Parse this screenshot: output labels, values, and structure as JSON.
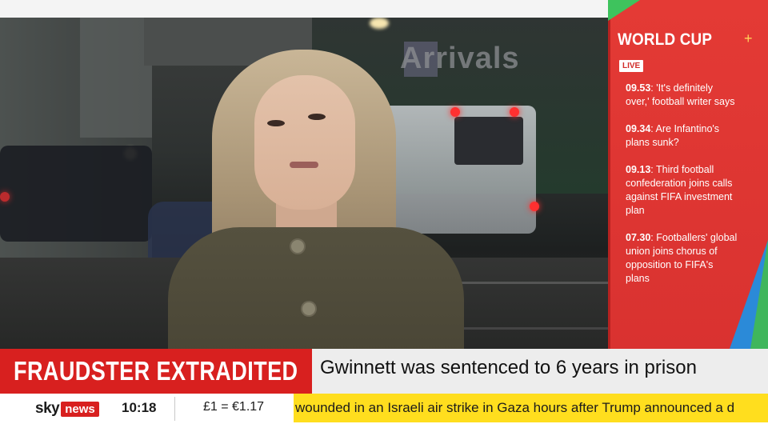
{
  "panel": {
    "title": "WORLD CUP",
    "live_label": "LIVE",
    "items": [
      {
        "time": "09.53",
        "text": ": 'It's definitely over,' football writer says"
      },
      {
        "time": "09.34",
        "text": ": Are Infantino's plans sunk?"
      },
      {
        "time": "09.13",
        "text": ": Third football confederation joins calls against FIFA investment plan"
      },
      {
        "time": "07.30",
        "text": ": Footballers' global union joins chorus of opposition to FIFA's plans"
      }
    ]
  },
  "scene": {
    "sign_text": "Arrivals"
  },
  "headline": {
    "label": "FRAUDSTER EXTRADITED",
    "text": "Gwinnett was sentenced to 6 years in prison"
  },
  "ticker": {
    "brand": "sky",
    "brand_box": "news",
    "time": "10:18",
    "exchange": "£1 = €1.17",
    "crawl": "wounded in an Israeli air strike in Gaza hours after Trump announced a d"
  },
  "colors": {
    "brand_red": "#d8201f",
    "panel_red": "#e43a35",
    "crawl_yellow": "#ffde1e"
  }
}
